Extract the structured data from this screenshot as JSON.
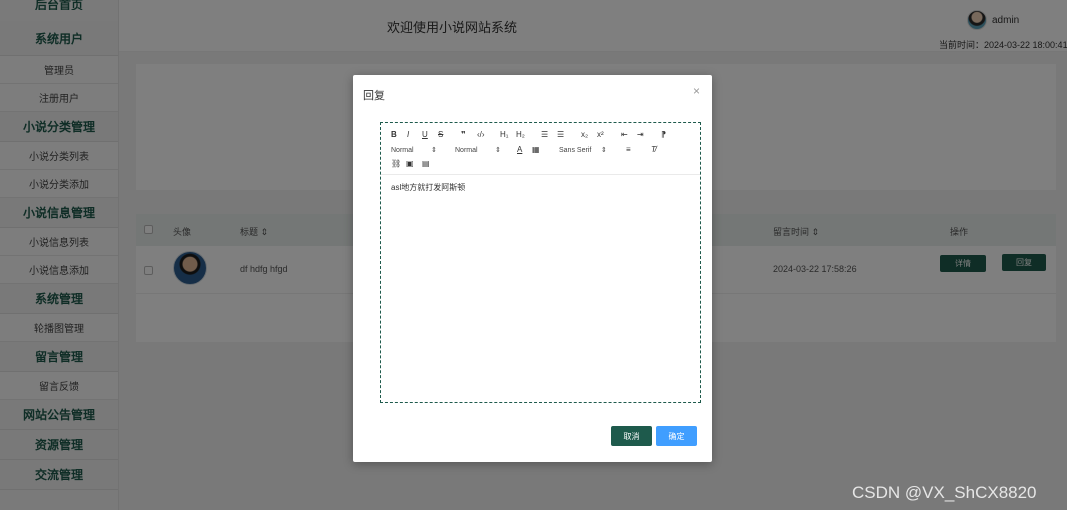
{
  "sidebar": {
    "top_partial": "后台首页",
    "groups": [
      {
        "label": "系统用户",
        "items": [
          "管理员",
          "注册用户"
        ]
      },
      {
        "label": "小说分类管理",
        "items": [
          "小说分类列表",
          "小说分类添加"
        ]
      },
      {
        "label": "小说信息管理",
        "items": [
          "小说信息列表",
          "小说信息添加"
        ]
      },
      {
        "label": "系统管理",
        "items": [
          "轮播图管理"
        ]
      },
      {
        "label": "留言管理",
        "items": [
          "留言反馈"
        ]
      },
      {
        "label": "网站公告管理",
        "items": []
      },
      {
        "label": "资源管理",
        "items": []
      },
      {
        "label": "交流管理",
        "items": []
      }
    ]
  },
  "header": {
    "title": "欢迎使用小说网站系统",
    "user": "admin",
    "time": "当前时间：2024-03-22 18:00:41"
  },
  "table": {
    "headers": [
      "头像",
      "标题 ⇕",
      "留言时间 ⇕",
      "操作"
    ],
    "row": {
      "title": "df hdfg hfgd",
      "time": "2024-03-22 17:58:26",
      "detail_label": "详情",
      "reply_label": "回复"
    }
  },
  "dialog": {
    "title": "回复",
    "close": "×",
    "toolbar": {
      "bold": "B",
      "italic": "I",
      "underline": "U",
      "strike": "S",
      "quote": "❞",
      "code": "‹/›",
      "h1": "H₁",
      "h2": "H₂",
      "ol": "☰",
      "ul": "☰",
      "sub": "x₂",
      "sup": "x²",
      "outdent": "⇤",
      "indent": "⇥",
      "rtl": "⁋",
      "size": "Normal",
      "header": "Normal",
      "color": "A",
      "bg": "▦",
      "font": "Sans Serif",
      "align": "≡",
      "clean": "T̸",
      "link": "⛓",
      "image": "▣",
      "video": "▤"
    },
    "content": "asl地方就打发阿斯顿",
    "cancel_label": "取消",
    "ok_label": "确定"
  },
  "watermark": "CSDN @VX_ShCX8820",
  "colors": {
    "primary": "#1e5a4c",
    "confirm": "#409eff"
  }
}
